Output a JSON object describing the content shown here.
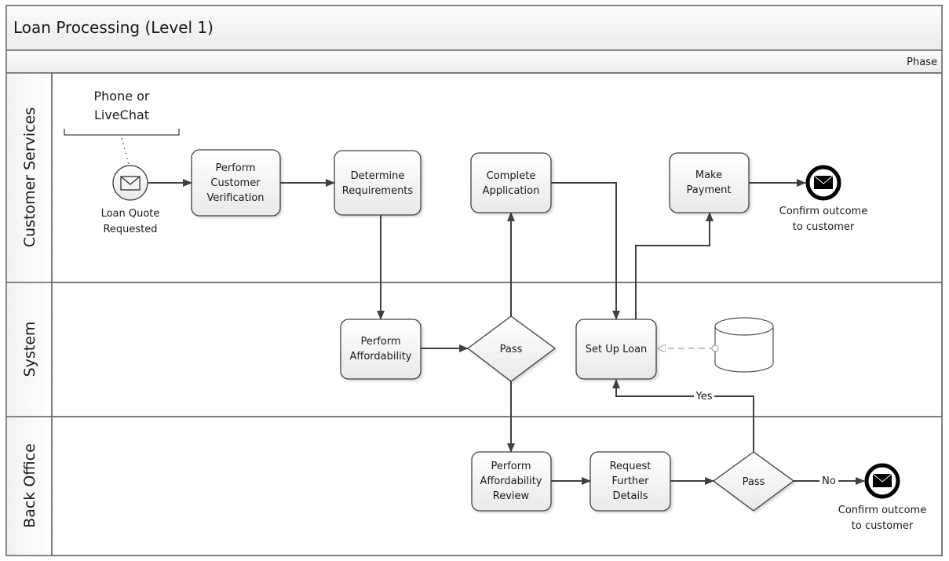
{
  "title": "Loan Processing (Level 1)",
  "phase_label": "Phase",
  "lanes": [
    {
      "id": "cs",
      "label": "Customer Services"
    },
    {
      "id": "sys",
      "label": "System"
    },
    {
      "id": "bo",
      "label": "Back Office"
    }
  ],
  "annotation": {
    "lines": [
      "Phone or",
      "LiveChat"
    ]
  },
  "start_event": {
    "icon": "envelope-icon",
    "lines": [
      "Loan Quote",
      "Requested"
    ]
  },
  "tasks": {
    "verify": {
      "lines": [
        "Perform",
        "Customer",
        "Verification"
      ]
    },
    "requirements": {
      "lines": [
        "Determine",
        "Requirements"
      ]
    },
    "complete_app": {
      "lines": [
        "Complete",
        "Application"
      ]
    },
    "make_payment": {
      "lines": [
        "Make",
        "Payment"
      ]
    },
    "affordability": {
      "lines": [
        "Perform",
        "Affordability"
      ]
    },
    "setup_loan": {
      "lines": [
        "Set Up Loan"
      ]
    },
    "aff_review": {
      "lines": [
        "Perform",
        "Affordability",
        "Review"
      ]
    },
    "request_details": {
      "lines": [
        "Request",
        "Further",
        "Details"
      ]
    }
  },
  "gateways": {
    "pass_system": {
      "label": "Pass"
    },
    "pass_backoffice": {
      "label": "Pass"
    }
  },
  "end_events": {
    "end_cs": {
      "icon": "envelope-filled-icon",
      "lines": [
        "Confirm outcome",
        "to customer"
      ]
    },
    "end_bo": {
      "icon": "envelope-filled-icon",
      "lines": [
        "Confirm outcome",
        "to customer"
      ]
    }
  },
  "flow_labels": {
    "yes": "Yes",
    "no": "No"
  },
  "data_store": {
    "icon": "database-icon"
  },
  "colors": {
    "border": "#6b6b6b",
    "line": "#404040",
    "task_fill_top": "#ffffff",
    "task_fill_bottom": "#ebebeb",
    "header_fill": "#f5f5f5",
    "association": "#a0a0a0"
  }
}
